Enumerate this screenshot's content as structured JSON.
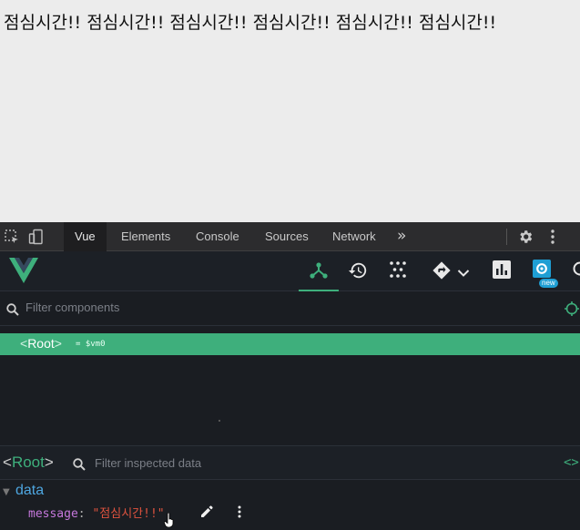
{
  "page": {
    "text": "점심시간!! 점심시간!! 점심시간!! 점심시간!! 점심시간!! 점심시간!!"
  },
  "devtools": {
    "tabs": [
      {
        "label": "Vue"
      },
      {
        "label": "Elements"
      },
      {
        "label": "Console"
      },
      {
        "label": "Sources"
      },
      {
        "label": "Network"
      }
    ],
    "more_label": "»",
    "active_tab": "Vue"
  },
  "vue_toolbar": {
    "new_badge": "new",
    "icons": [
      "components-icon",
      "timeline-icon",
      "plugins-icon",
      "router-icon",
      "performance-icon",
      "settings-icon"
    ]
  },
  "component_filter": {
    "placeholder": "Filter components"
  },
  "tree": {
    "root_open": "<",
    "root_name": "Root",
    "root_close": ">",
    "root_ref": "= $vm0"
  },
  "inspector": {
    "open": "<",
    "name": "Root",
    "close": ">",
    "placeholder": "Filter inspected data",
    "code_icon": "<>",
    "section": "data",
    "props": [
      {
        "key": "message",
        "colon": ":",
        "value": "\"점심시간!!\""
      }
    ]
  },
  "colors": {
    "vue_green": "#3eaf7c",
    "panel_bg": "#1a1d22",
    "key_purple": "#c678dd",
    "string_red": "#e0533f"
  }
}
